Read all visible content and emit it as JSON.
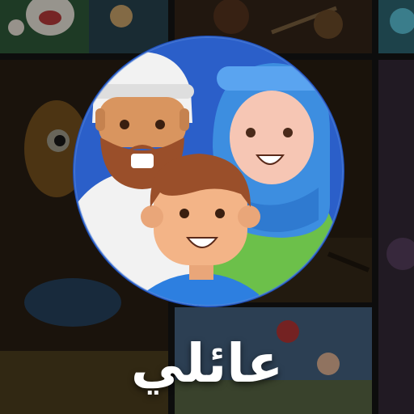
{
  "category": {
    "label": "عائلي",
    "icon": "family-icon"
  },
  "colors": {
    "emblem_background": "#2b5fc9",
    "emblem_ring": "#5a8be0",
    "father_headwear": "#f2f2f2",
    "mother_headscarf": "#3d8ee0",
    "mother_dress": "#6cc04a",
    "child_shirt": "#2d7fe0",
    "skin_father": "#d9955f",
    "skin_mother": "#f6c6b4",
    "skin_child": "#f3b487",
    "hair_brown": "#9a4f2a",
    "caption_text": "#ffffff"
  },
  "background_tiles": [
    {
      "icon": "cartoon-thumbnail-icon"
    },
    {
      "icon": "cartoon-thumbnail-icon"
    },
    {
      "icon": "cartoon-thumbnail-icon"
    },
    {
      "icon": "cartoon-thumbnail-icon"
    },
    {
      "icon": "cartoon-thumbnail-icon"
    },
    {
      "icon": "cartoon-thumbnail-icon"
    },
    {
      "icon": "cartoon-thumbnail-icon"
    }
  ]
}
